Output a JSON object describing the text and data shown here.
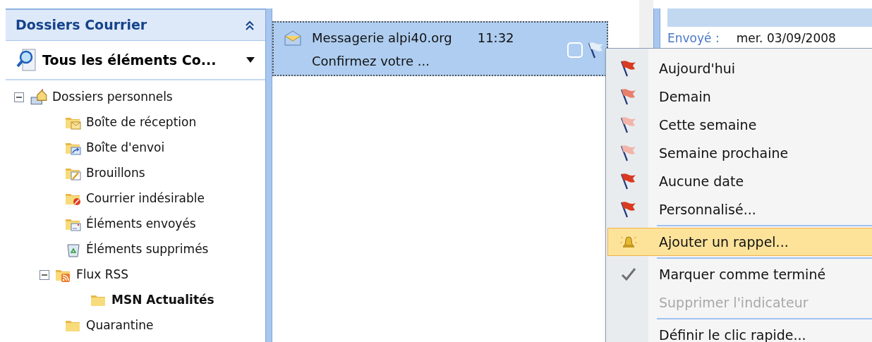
{
  "folders_pane": {
    "title": "Dossiers Courrier",
    "view_selector": "Tous les éléments Co...",
    "tree": [
      {
        "label": "Dossiers personnels",
        "kind": "personal",
        "expanded": true,
        "bold": false,
        "children": [
          {
            "label": "Boîte de réception",
            "kind": "inbox",
            "bold": false
          },
          {
            "label": "Boîte d'envoi",
            "kind": "outbox",
            "bold": false
          },
          {
            "label": "Brouillons",
            "kind": "drafts",
            "bold": false
          },
          {
            "label": "Courrier indésirable",
            "kind": "junk",
            "bold": false
          },
          {
            "label": "Éléments envoyés",
            "kind": "sent",
            "bold": false
          },
          {
            "label": "Éléments supprimés",
            "kind": "deleted",
            "bold": false
          },
          {
            "label": "Flux RSS",
            "kind": "rss",
            "expanded": true,
            "bold": false,
            "children": [
              {
                "label": "MSN Actualités",
                "kind": "folder",
                "bold": true
              }
            ]
          },
          {
            "label": "Quarantine",
            "kind": "folder",
            "bold": false
          }
        ]
      }
    ]
  },
  "message_list": {
    "messages": [
      {
        "sender": "Messagerie alpi40.org",
        "time": "11:32",
        "subject": "Confirmez votre ...",
        "selected": true
      }
    ]
  },
  "reading_pane": {
    "sent_label": "Envoyé :",
    "sent_value": "mer. 03/09/2008"
  },
  "context_menu": {
    "items": [
      {
        "kind": "flag",
        "label": "Aujourd'hui",
        "color": "#d83a22",
        "selected": false,
        "disabled": false
      },
      {
        "kind": "flag",
        "label": "Demain",
        "color": "#e8806c",
        "selected": false,
        "disabled": false
      },
      {
        "kind": "flag",
        "label": "Cette semaine",
        "color": "#f2b5aa",
        "selected": false,
        "disabled": false
      },
      {
        "kind": "flag",
        "label": "Semaine prochaine",
        "color": "#f2b5aa",
        "selected": false,
        "disabled": false
      },
      {
        "kind": "flag",
        "label": "Aucune date",
        "color": "#d83a22",
        "selected": false,
        "disabled": false
      },
      {
        "kind": "flag",
        "label": "Personnalisé...",
        "color": "#d83a22",
        "selected": false,
        "disabled": false
      },
      {
        "kind": "separator"
      },
      {
        "kind": "bell",
        "label": "Ajouter un rappel...",
        "selected": true,
        "disabled": false
      },
      {
        "kind": "separator"
      },
      {
        "kind": "check",
        "label": "Marquer comme terminé",
        "selected": false,
        "disabled": false
      },
      {
        "kind": "plain",
        "label": "Supprimer l'indicateur",
        "selected": false,
        "disabled": true
      },
      {
        "kind": "separator"
      },
      {
        "kind": "plain",
        "label": "Définir le clic rapide...",
        "selected": false,
        "disabled": false
      }
    ]
  }
}
